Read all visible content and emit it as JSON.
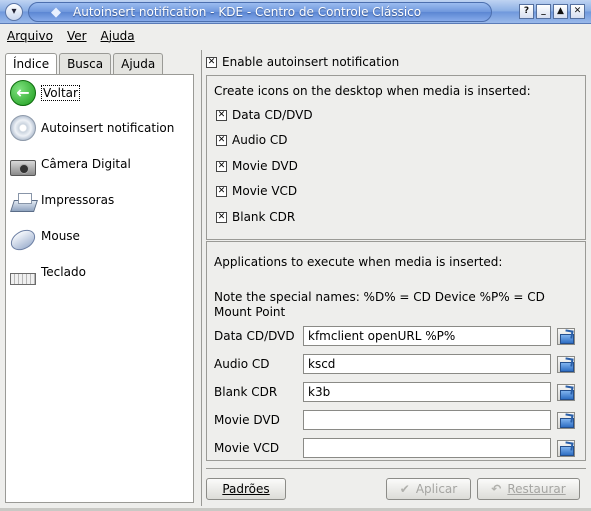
{
  "window": {
    "title": "Autoinsert notification - KDE - Centro de Controle Clássico",
    "menu_glyph": "▾",
    "buttons": {
      "help": "?",
      "minimize": "_",
      "maximize": "▲",
      "close": "✕"
    }
  },
  "menubar": [
    {
      "label": "Arquivo"
    },
    {
      "label": "Ver"
    },
    {
      "label": "Ajuda"
    }
  ],
  "sidebar": {
    "tabs": [
      {
        "label": "Índice",
        "active": true
      },
      {
        "label": "Busca",
        "active": false
      },
      {
        "label": "Ajuda",
        "active": false
      }
    ],
    "items": [
      {
        "label": "Voltar",
        "icon": "back-arrow-icon"
      },
      {
        "label": "Autoinsert notification",
        "icon": "cd-icon"
      },
      {
        "label": "Câmera Digital",
        "icon": "camera-icon"
      },
      {
        "label": "Impressoras",
        "icon": "printer-icon"
      },
      {
        "label": "Mouse",
        "icon": "mouse-icon"
      },
      {
        "label": "Teclado",
        "icon": "keyboard-icon"
      }
    ]
  },
  "main": {
    "enable_label": "Enable autoinsert notification",
    "enable_checked": true,
    "icons_group": {
      "title": "Create icons on the desktop when media is inserted:",
      "options": [
        {
          "label": "Data CD/DVD",
          "checked": true
        },
        {
          "label": "Audio CD",
          "checked": true
        },
        {
          "label": "Movie DVD",
          "checked": true
        },
        {
          "label": "Movie VCD",
          "checked": true
        },
        {
          "label": "Blank CDR",
          "checked": true
        }
      ]
    },
    "apps_group": {
      "title": "Applications to execute when media is inserted:",
      "note": "Note the special names: %D% = CD Device %P% = CD Mount Point",
      "rows": [
        {
          "label": "Data CD/DVD",
          "value": "kfmclient openURL %P%"
        },
        {
          "label": "Audio CD",
          "value": "kscd"
        },
        {
          "label": "Blank CDR",
          "value": "k3b"
        },
        {
          "label": "Movie DVD",
          "value": ""
        },
        {
          "label": "Movie VCD",
          "value": ""
        }
      ]
    },
    "buttons": {
      "defaults": "Padrões",
      "apply": "Aplicar",
      "reset": "Restaurar"
    }
  }
}
